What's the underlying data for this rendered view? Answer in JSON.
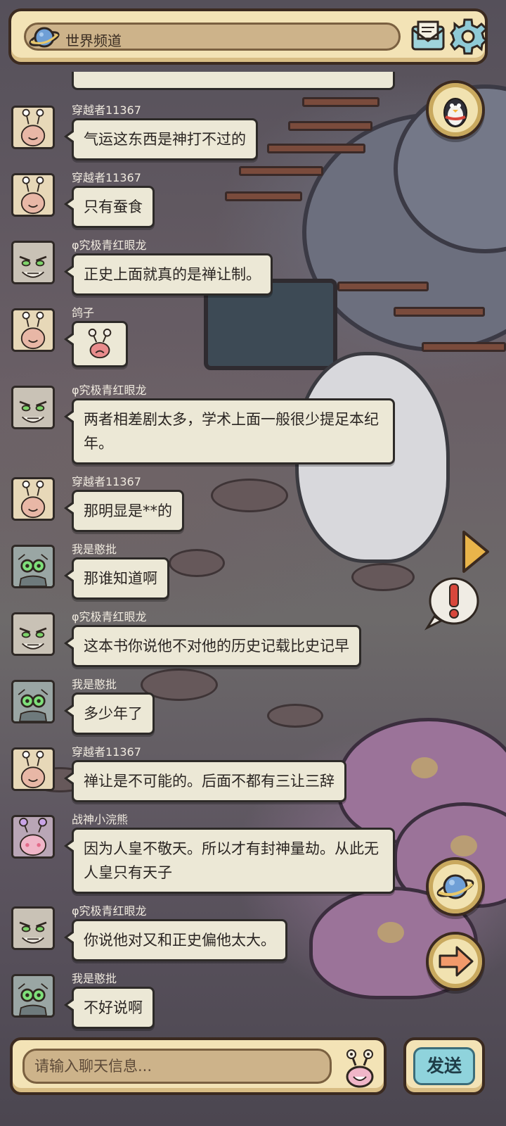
{
  "header": {
    "channel_title": "世界频道"
  },
  "messages": [
    {
      "user": "穿越者11367",
      "text": "气运这东西是神打不过的",
      "avatar": "snail-avatar-icon"
    },
    {
      "user": "穿越者11367",
      "text": "只有蚕食",
      "avatar": "snail-avatar-icon"
    },
    {
      "user": "φ究极青红眼龙",
      "text": "正史上面就真的是禅让制。",
      "avatar": "grumpy-face-avatar-icon"
    },
    {
      "user": "鸽子",
      "text": "",
      "avatar": "snail-avatar-icon",
      "sticker": "snail-sticker-icon"
    },
    {
      "user": "φ究极青红眼龙",
      "text": "两者相差剧太多，学术上面一般很少提足本纪年。",
      "avatar": "grumpy-face-avatar-icon"
    },
    {
      "user": "穿越者11367",
      "text": "那明显是**的",
      "avatar": "snail-avatar-icon"
    },
    {
      "user": "我是憨批",
      "text": "那谁知道啊",
      "avatar": "goggle-creature-avatar-icon"
    },
    {
      "user": "φ究极青红眼龙",
      "text": "这本书你说他不对他的历史记载比史记早",
      "avatar": "grumpy-face-avatar-icon"
    },
    {
      "user": "我是憨批",
      "text": "多少年了",
      "avatar": "goggle-creature-avatar-icon"
    },
    {
      "user": "穿越者11367",
      "text": "禅让是不可能的。后面不都有三让三辞",
      "avatar": "snail-avatar-icon"
    },
    {
      "user": "战神小浣熊",
      "text": "因为人皇不敬天。所以才有封神量劫。从此无人皇只有天子",
      "avatar": "pink-snail-avatar-icon"
    },
    {
      "user": "φ究极青红眼龙",
      "text": "你说他对又和正史偏他太大。",
      "avatar": "grumpy-face-avatar-icon"
    },
    {
      "user": "我是憨批",
      "text": "不好说啊",
      "avatar": "goggle-creature-avatar-icon"
    }
  ],
  "composer": {
    "placeholder": "请输入聊天信息...",
    "send_label": "发送"
  },
  "colors": {
    "panel": "#f3e3b6",
    "bubble": "#ece8d6",
    "send_button": "#8fd3dc",
    "username": "#f0eadf"
  }
}
